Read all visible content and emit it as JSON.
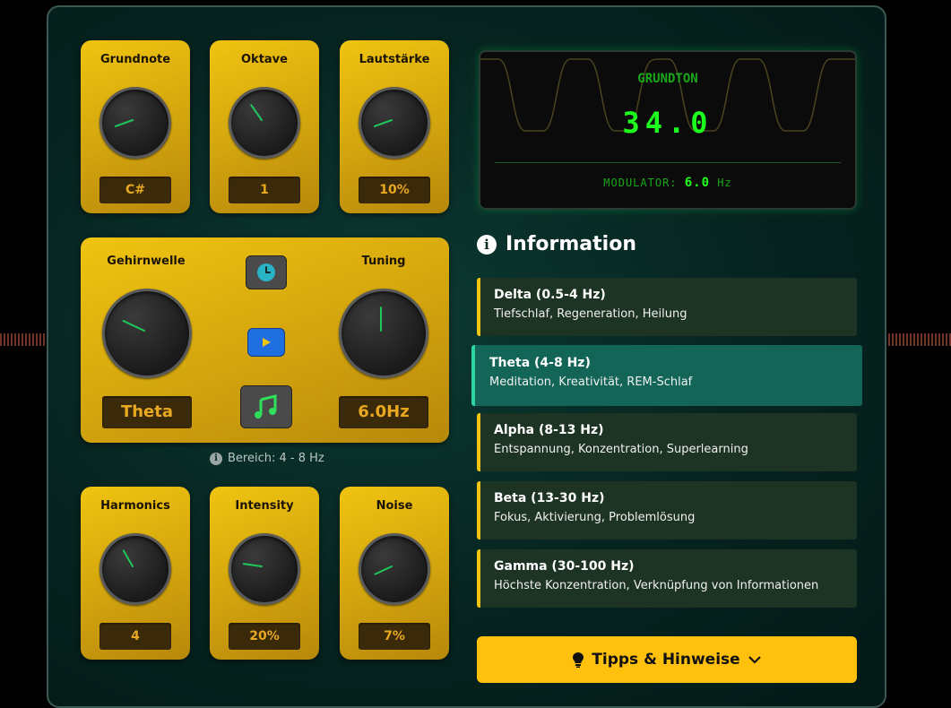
{
  "top_knobs": [
    {
      "label": "Grundnote",
      "value": "C#",
      "angle": 250
    },
    {
      "label": "Oktave",
      "value": "1",
      "angle": 325
    },
    {
      "label": "Lautstärke",
      "value": "10%",
      "angle": 250
    }
  ],
  "brainwave": {
    "label": "Gehirnwelle",
    "value": "Theta",
    "angle": 295,
    "tuning_label": "Tuning",
    "tuning_value": "6.0Hz",
    "tuning_angle": 0,
    "range": "Bereich: 4 - 8 Hz"
  },
  "bottom_knobs": [
    {
      "label": "Harmonics",
      "value": "4",
      "angle": 330
    },
    {
      "label": "Intensity",
      "value": "20%",
      "angle": 278
    },
    {
      "label": "Noise",
      "value": "7%",
      "angle": 245
    }
  ],
  "display": {
    "title": "GRUNDTON",
    "value": "34.0",
    "modulator_label": "MODULATOR:",
    "modulator_value": "6.0",
    "modulator_unit": "Hz"
  },
  "info": {
    "title": "Information",
    "waves": [
      {
        "title": "Delta (0.5-4 Hz)",
        "desc": "Tiefschlaf, Regeneration, Heilung"
      },
      {
        "title": "Theta (4-8 Hz)",
        "desc": "Meditation, Kreativität, REM-Schlaf"
      },
      {
        "title": "Alpha (8-13 Hz)",
        "desc": "Entspannung, Konzentration, Superlearning"
      },
      {
        "title": "Beta (13-30 Hz)",
        "desc": "Fokus, Aktivierung, Problemlösung"
      },
      {
        "title": "Gamma (30-100 Hz)",
        "desc": "Höchste Konzentration, Verknüpfung von Informationen"
      }
    ]
  },
  "tips": {
    "label": "Tipps & Hinweise"
  },
  "colors": {
    "panel": "#f0c410",
    "accent": "#1dff1d",
    "active_card": "#136657",
    "tips": "#ffc10e"
  }
}
